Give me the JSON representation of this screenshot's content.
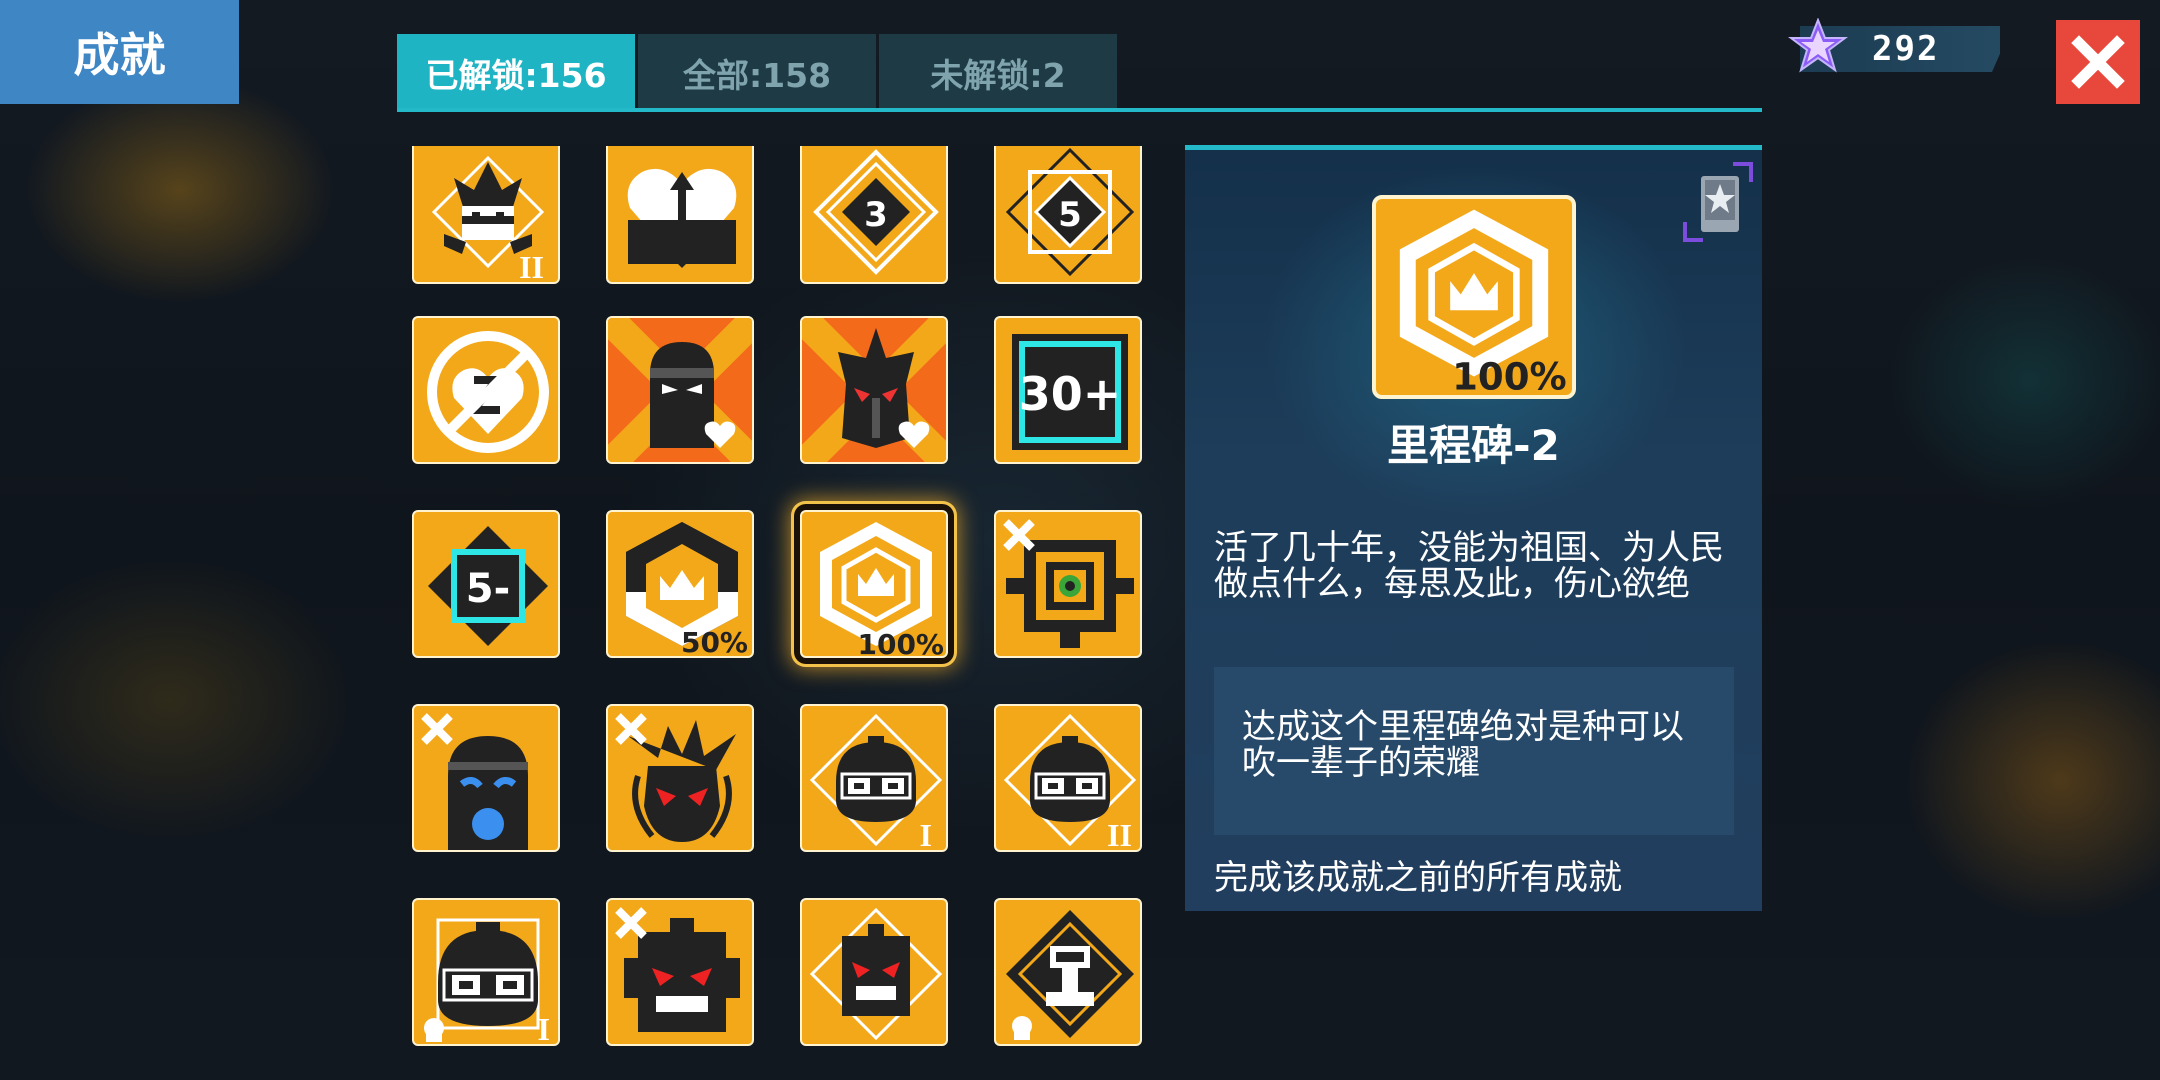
{
  "header": {
    "title": "成就"
  },
  "tabs": [
    {
      "label": "已解锁:156",
      "active": true
    },
    {
      "label": "全部:158",
      "active": false
    },
    {
      "label": "未解锁:2",
      "active": false
    }
  ],
  "currency": {
    "icon": "purple-star-gem-icon",
    "value": "292"
  },
  "close": {
    "icon": "close-x-icon"
  },
  "achievements": [
    {
      "icon": "spiky-hair-masked-head-badge",
      "tier": "II"
    },
    {
      "icon": "heart-arrow-up-badge"
    },
    {
      "icon": "diamond-number-badge",
      "number": "3"
    },
    {
      "icon": "diamond-number-badge",
      "number": "5"
    },
    {
      "icon": "no-broken-heart-badge"
    },
    {
      "icon": "ninja-heart-badge"
    },
    {
      "icon": "dark-knight-heart-badge"
    },
    {
      "icon": "thirty-plus-badge",
      "text": "30+"
    },
    {
      "icon": "five-minus-badge",
      "text": "5-"
    },
    {
      "icon": "milestone-crown-badge",
      "percent": "50%"
    },
    {
      "icon": "milestone-crown-badge",
      "percent": "100%",
      "selected": true
    },
    {
      "icon": "target-eye-badge",
      "crossed": true
    },
    {
      "icon": "sad-blue-face-badge",
      "crossed": true
    },
    {
      "icon": "spiky-red-eyes-badge",
      "crossed": true
    },
    {
      "icon": "goggles-head-badge",
      "tier": "I"
    },
    {
      "icon": "goggles-head-badge",
      "tier": "II"
    },
    {
      "icon": "goggles-head-skull-badge",
      "tier": "I"
    },
    {
      "icon": "robot-red-eyes-badge",
      "crossed": true
    },
    {
      "icon": "robot-red-eyes-diamond-badge"
    },
    {
      "icon": "tower-diamond-skull-badge"
    }
  ],
  "detail": {
    "icon": "milestone-crown-badge",
    "percent": "100%",
    "title": "里程碑-2",
    "quote": "活了几十年，没能为祖国、为人民做点什么，每思及此，伤心欲绝",
    "description": "达成这个里程碑绝对是种可以吹一辈子的荣耀",
    "requirement": "完成该成就之前的所有成就",
    "share_icon": "share-card-icon"
  },
  "colors": {
    "accent": "#23b9c8",
    "badge": "#f3a81a",
    "close": "#e8473b",
    "title_bg": "#3f86c5"
  }
}
